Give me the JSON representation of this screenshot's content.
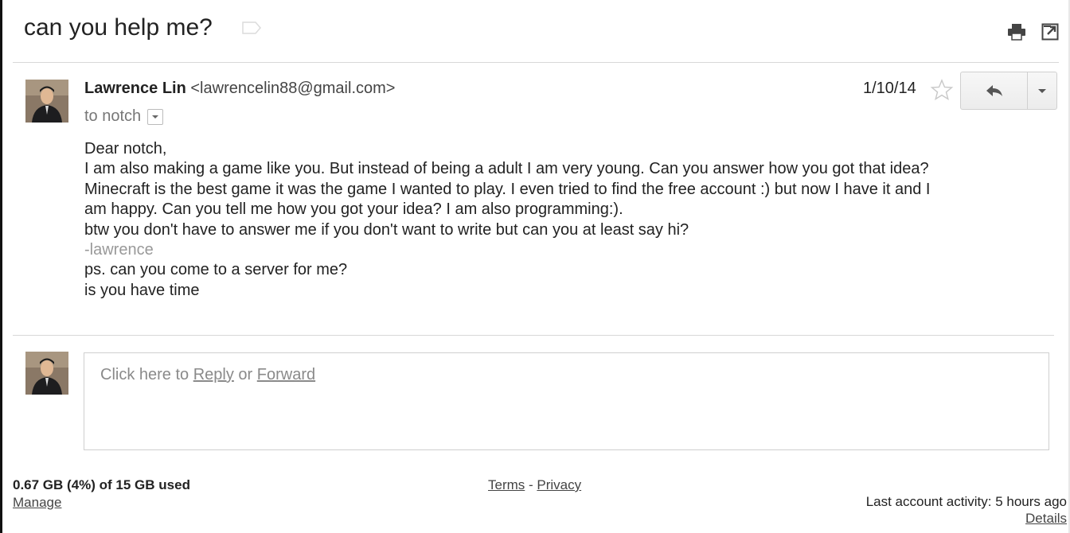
{
  "subject": "can you help me?",
  "message": {
    "sender_name": "Lawrence Lin",
    "sender_email": "<lawrencelin88@gmail.com>",
    "recipient_text": "to notch",
    "date": "1/10/14",
    "body_lines": [
      "Dear notch,",
      "I am also making a game like you. But instead of being a adult I am very young. Can you answer how you got that idea?",
      "Minecraft is the best game it was the game I wanted to play. I even tried to find the free account :) but now I have it and I",
      "am happy. Can you tell me how you got your idea? I am also programming:).",
      "btw you don't have to answer me if you don't want to write but can you at least say hi?"
    ],
    "signature": "-lawrence",
    "postscript_lines": [
      "ps. can you come to a server for me?",
      "is you have time"
    ]
  },
  "reply_box": {
    "prefix": "Click here to ",
    "reply_link": "Reply",
    "middle": " or ",
    "forward_link": "Forward"
  },
  "footer": {
    "storage": "0.67 GB (4%) of 15 GB used",
    "manage": "Manage",
    "terms": "Terms",
    "separator": " - ",
    "privacy": "Privacy",
    "activity": "Last account activity: 5 hours ago",
    "details": "Details"
  },
  "icons": {
    "label": "label-tag-icon",
    "print": "print-icon",
    "new_window": "new-window-icon",
    "dropdown": "chevron-down-icon",
    "star": "star-icon",
    "reply": "reply-icon",
    "more": "caret-down-icon"
  }
}
